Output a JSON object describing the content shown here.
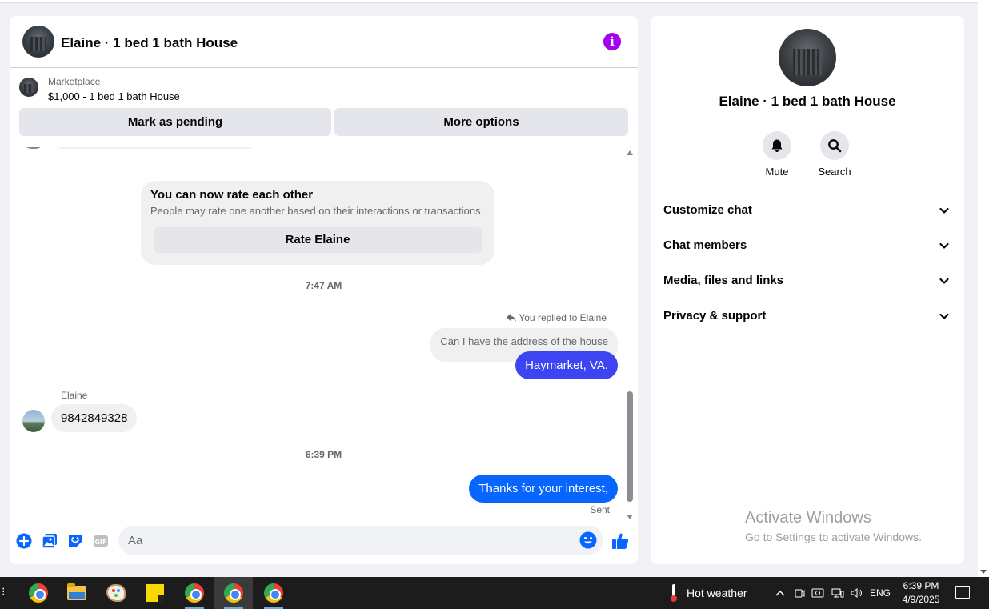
{
  "chat": {
    "title": "Elaine · 1 bed 1 bath House",
    "marketplace_label": "Marketplace",
    "listing": "$1,000 - 1 bed 1 bath House",
    "mark_pending_label": "Mark as pending",
    "more_options_label": "More options"
  },
  "thread": {
    "rate_title": "You can now rate each other",
    "rate_subtitle": "People may rate one another based on their interactions or transactions.",
    "rate_button": "Rate Elaine",
    "timestamp_1": "7:47 AM",
    "replied_label": "You replied to Elaine",
    "quoted_text": "Can I have the address of the house",
    "outgoing_1": "Haymarket, VA.",
    "sender_name": "Elaine",
    "incoming_1": "9842849328",
    "timestamp_2": "6:39 PM",
    "outgoing_2": "Thanks for your interest,",
    "sent_status": "Sent"
  },
  "composer": {
    "placeholder": "Aa",
    "icons": [
      "plus-icon",
      "photo-icon",
      "sticker-icon",
      "gif-icon",
      "emoji-icon",
      "thumbs-up-icon"
    ]
  },
  "info_panel": {
    "title": "Elaine · 1 bed 1 bath House",
    "mute_label": "Mute",
    "search_label": "Search",
    "sections": [
      "Customize chat",
      "Chat members",
      "Media, files and links",
      "Privacy & support"
    ]
  },
  "watermark": {
    "line1": "Activate Windows",
    "line2": "Go to Settings to activate Windows."
  },
  "taskbar": {
    "weather": "Hot weather",
    "language": "ENG",
    "time": "6:39 PM",
    "date": "4/9/2025"
  },
  "colors": {
    "accent_blue": "#0866ff",
    "info_purple": "#a400f2",
    "bubble_outgoing_alt": "#3d45f2"
  }
}
